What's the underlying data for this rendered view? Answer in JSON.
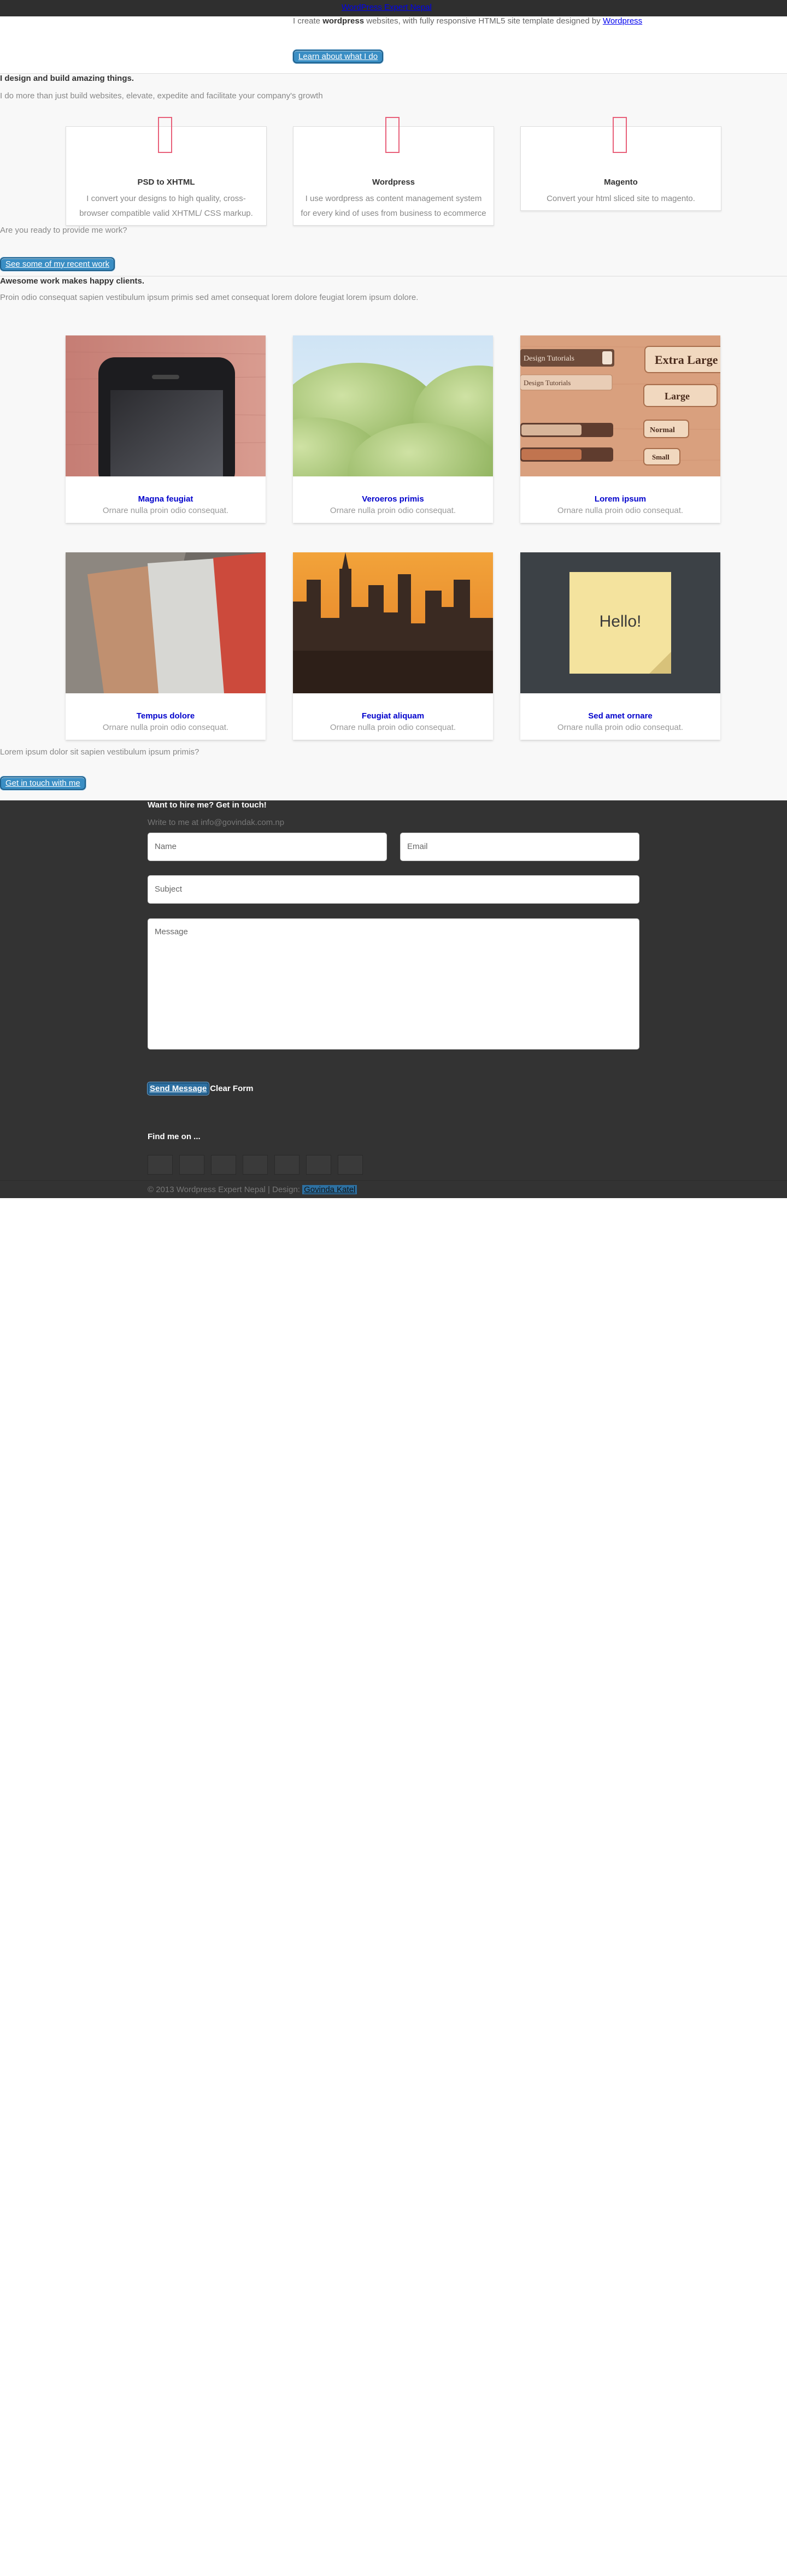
{
  "header": {
    "top_link": "WordPress Expert Nepal",
    "intro_prefix": "I create ",
    "intro_bold": "wordpress",
    "intro_middle": " websites, with fully responsive HTML5 site template designed by ",
    "intro_link": "Wordpress",
    "cta": "Learn about what I do"
  },
  "services": {
    "title": "I design and build amazing things.",
    "subtitle": "I do more than just build websites, elevate, expedite and facilitate your company's growth",
    "items": [
      {
        "title": "PSD to XHTML",
        "text": "I convert your designs to high quality, cross-browser compatible valid XHTML/ CSS markup.",
        "icon": "pink-outline-icon"
      },
      {
        "title": "Wordpress",
        "text": "I use wordpress as content management system for every kind of uses from business to ecommerce",
        "icon": "pink-outline-icon"
      },
      {
        "title": "Magento",
        "text": "Convert your html sliced site to magento.",
        "icon": "pink-outline-icon"
      }
    ],
    "question": "Are you ready to provide me work?",
    "cta": "See some of my recent work"
  },
  "work": {
    "title": "Awesome work makes happy clients.",
    "subtitle": "Proin odio consequat sapien vestibulum ipsum primis sed amet consequat lorem dolore feugiat lorem ipsum dolore.",
    "items": [
      {
        "title": "Magna feugiat",
        "text": "Ornare nulla proin odio consequat."
      },
      {
        "title": "Veroeros primis",
        "text": "Ornare nulla proin odio consequat."
      },
      {
        "title": "Lorem ipsum",
        "text": "Ornare nulla proin odio consequat."
      },
      {
        "title": "Tempus dolore",
        "text": "Ornare nulla proin odio consequat."
      },
      {
        "title": "Feugiat aliquam",
        "text": "Ornare nulla proin odio consequat."
      },
      {
        "title": "Sed amet ornare",
        "text": "Ornare nulla proin odio consequat."
      }
    ],
    "ui_kit": {
      "select1": "Design Tutorials",
      "select2": "Design Tutorials",
      "btn_xl": "Extra Large",
      "btn_l": "Large",
      "btn_n": "Normal",
      "btn_s": "Small"
    },
    "note_text": "Hello!",
    "question": "Lorem ipsum dolor sit sapien vestibulum ipsum primis?",
    "cta": "Get in touch with me"
  },
  "contact": {
    "title": "Want to hire me? Get in touch!",
    "mail": "Write to me at info@govindak.com.np",
    "name_placeholder": "Name",
    "email_placeholder": "Email",
    "subject_placeholder": "Subject",
    "message_placeholder": "Message",
    "send": "Send Message",
    "clear": "Clear Form",
    "findme": "Find me on ...",
    "copyright": "© 2013 Wordpress Expert Nepal | Design: ",
    "design_link": "Govinda Katel"
  },
  "colors": {
    "dark": "#333333",
    "topbar": "#2f2f2f",
    "accent": "#3a8ec4",
    "icon": "#e8607a"
  }
}
